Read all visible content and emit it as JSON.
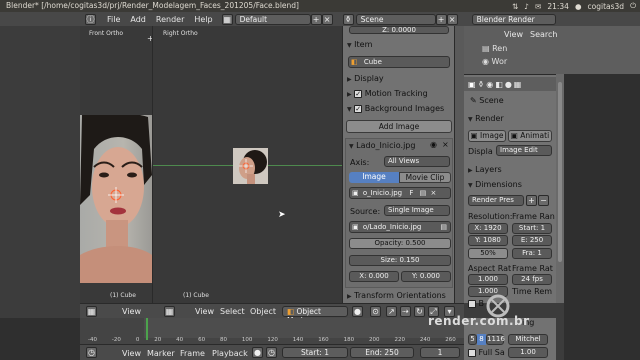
{
  "titlebar": {
    "title": "Blender* [/home/cogitas3d/prj/Render_Modelagem_Faces_201205/Face.blend]"
  },
  "tray": {
    "user": "cogitas3d",
    "time": "21:34"
  },
  "menubar": {
    "items": [
      "File",
      "Add",
      "Render",
      "Help"
    ],
    "layout_value": "Default",
    "scene_value": "Scene",
    "engine_value": "Blender Render"
  },
  "viewports": {
    "left_label": "Front Ortho",
    "right_label": "Right Ortho",
    "left_object": "(1) Cube",
    "right_object": "(1) Cube"
  },
  "viewport_header": {
    "left_view": "View",
    "view": "View",
    "select": "Select",
    "object": "Object",
    "mode": "Object Mode"
  },
  "props": {
    "top_field": "Z: 0.0000",
    "item_header": "Item",
    "item_name": "Cube",
    "display_header": "Display",
    "motion_tracking": "Motion Tracking",
    "background_images": "Background Images",
    "add_image": "Add Image",
    "bg_name": "Lado_Inicio.jpg",
    "axis_label": "Axis:",
    "axis_value": "All Views",
    "tab_image": "Image",
    "tab_movie": "Movie Clip",
    "image_file": "o_Inicio.jpg",
    "image_f": "F",
    "source_label": "Source:",
    "source_value": "Single Image",
    "path": "o/Lado_Inicio.jpg",
    "opacity": "Opacity: 0.500",
    "size": "Size: 0.150",
    "x": "X: 0.000",
    "y": "Y: 0.000",
    "transform_orientations": "Transform Orientations"
  },
  "outliner": {
    "view": "View",
    "search": "Search",
    "items": [
      "Ren",
      "Wor"
    ]
  },
  "render_panel": {
    "scene": "Scene",
    "render_header": "Render",
    "image_btn": "Image",
    "anim_btn": "Animati",
    "display_label": "Displa",
    "display_value": "Image Edit",
    "layers": "Layers",
    "dimensions": "Dimensions",
    "presets": "Render Pres",
    "resolution": "Resolution:",
    "frame_range": "Frame Ran",
    "res_x": "X: 1920",
    "res_y": "Y: 1080",
    "percent": "50%",
    "start": "Start: 1",
    "end": "E: 250",
    "fra": "Fra: 1",
    "aspect": "Aspect Rat",
    "frame_rate": "Frame Rat",
    "ax": "1.000",
    "ay": "1.000",
    "fps": "24 fps",
    "time_rem": "Time Rem",
    "b_label": "B",
    "threads_label": "ing",
    "sample_a": "5",
    "sample_b": "8",
    "sample_c": "1116",
    "mitchell": "Mitchel",
    "full_sample": "Full Sa",
    "size_val": "1.00"
  },
  "timeline": {
    "ticks": [
      "-40",
      "-20",
      "0",
      "20",
      "40",
      "60",
      "80",
      "100",
      "120",
      "140",
      "160",
      "180",
      "200",
      "220",
      "240",
      "260"
    ],
    "view": "View",
    "marker": "Marker",
    "frame": "Frame",
    "playback": "Playback",
    "start": "Start: 1",
    "end": "End: 250",
    "current": "1"
  },
  "watermark": "render.com.br"
}
